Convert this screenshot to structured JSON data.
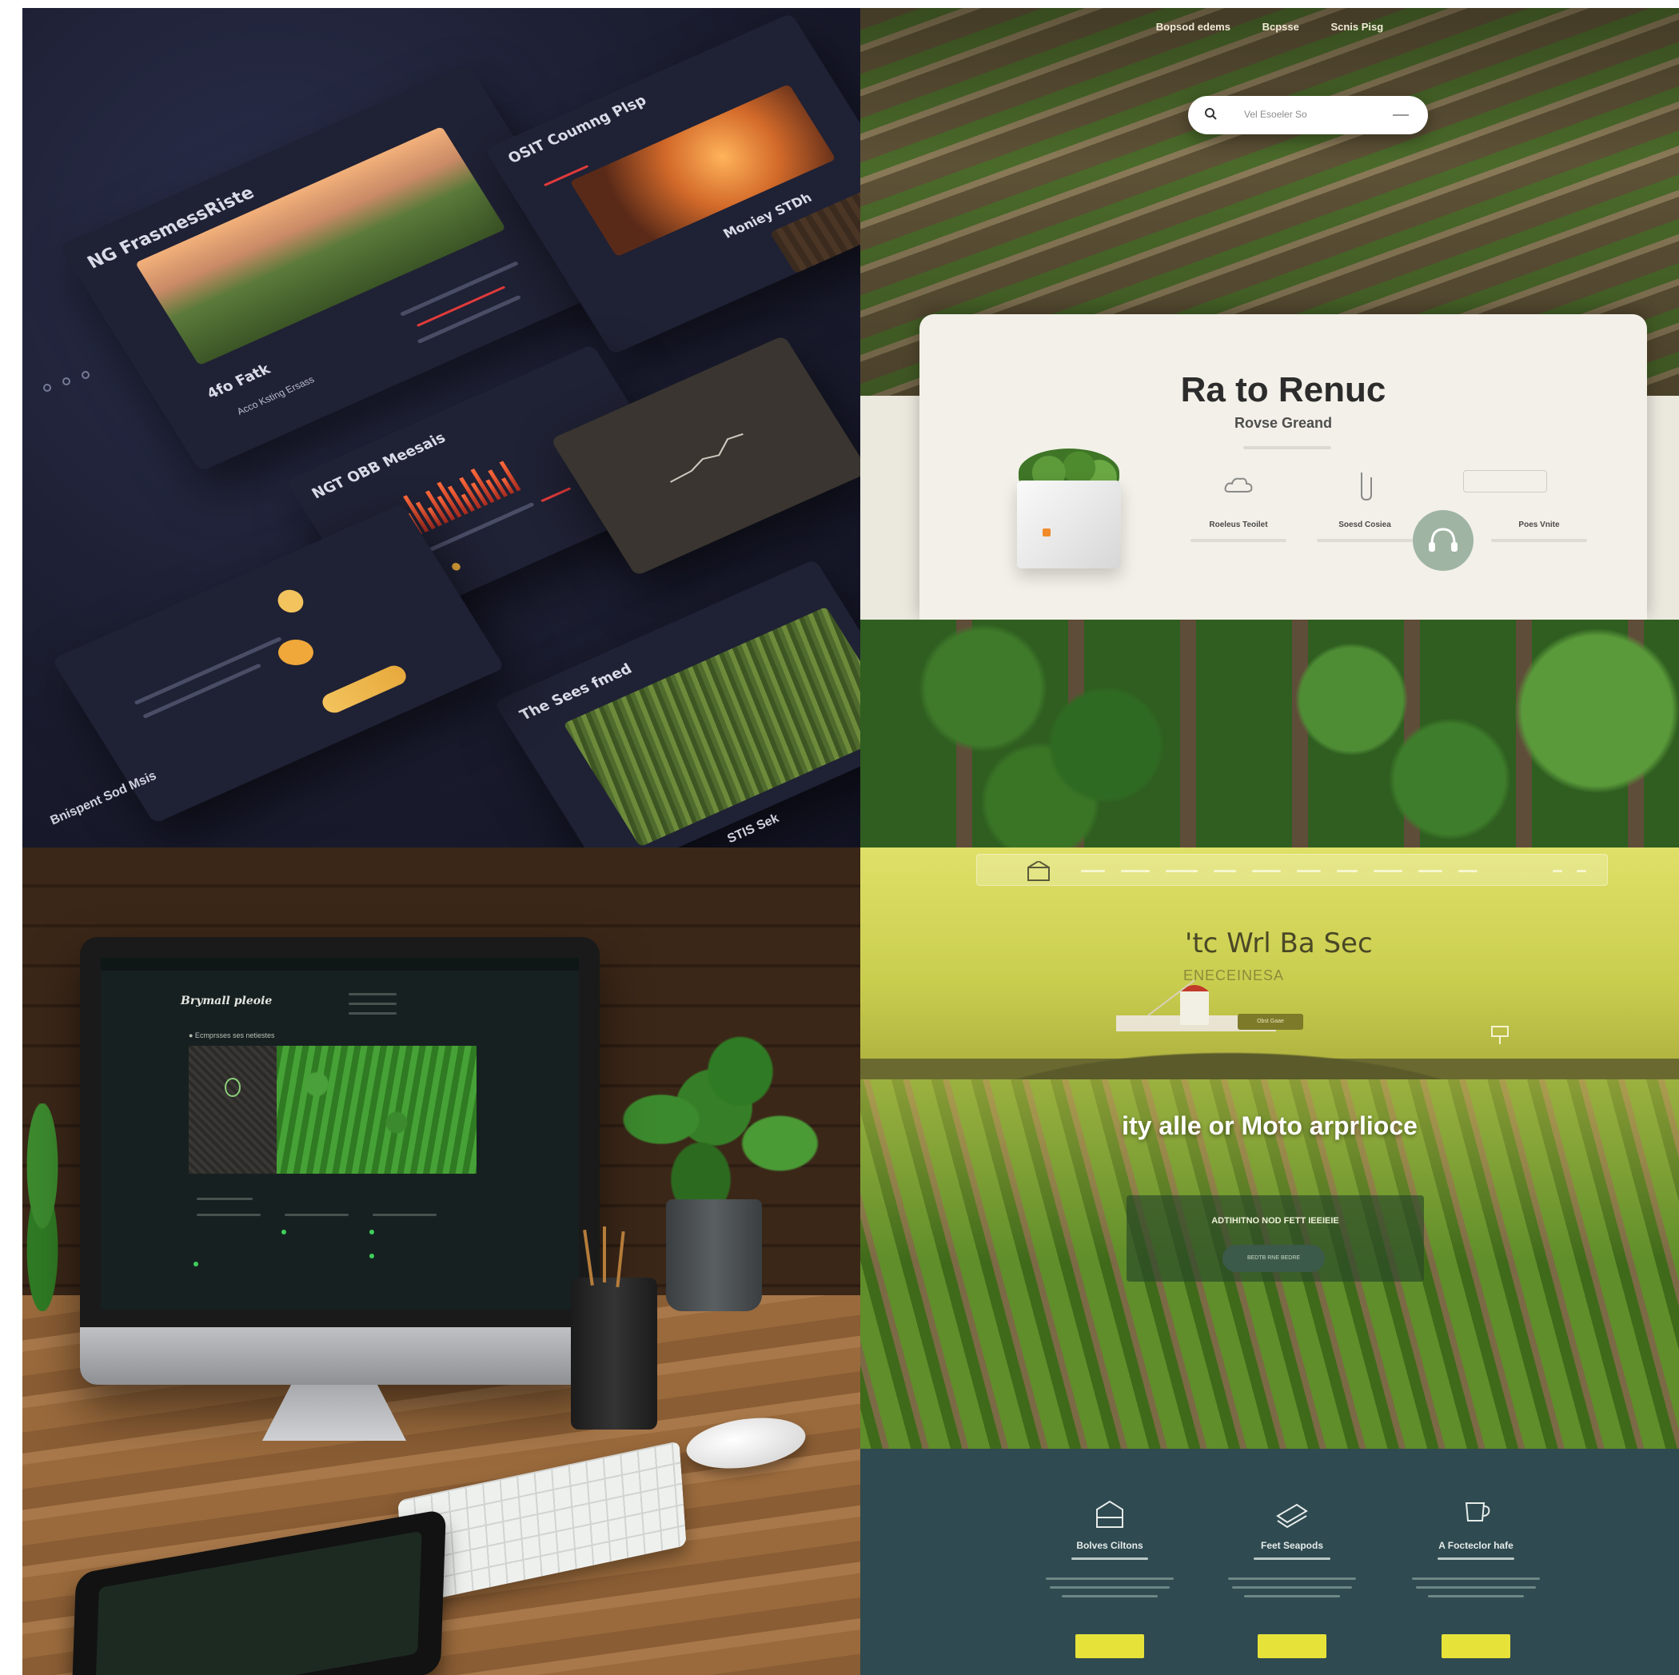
{
  "panels": {
    "top_left": {
      "card_main_title": "NG FrasmessRiste",
      "card_main_sub": "4fo Fatk",
      "card_main_item": "Acco Ksting Ersass",
      "card_top_title": "OSIT Coumng Plsp",
      "card_top_label": "Moniey STDh",
      "card_mid_title": "NGT OBB Meesais",
      "card_seed_title": "The Sees fmed",
      "card_bottom_title": "Bnispent Sod Msis",
      "card_bottom_label": "STIS Sek"
    },
    "top_right": {
      "nav_items": [
        "Bopsod edems",
        "Bcpsse",
        "Scnis Pisg"
      ],
      "search_placeholder": "Vel Esoeler So",
      "panel_title": "Ra to Renuc",
      "panel_subtitle": "Rovse Greand",
      "features": [
        {
          "label": "Roeleus Teoilet",
          "icon": "cloud-icon"
        },
        {
          "label": "Soesd Cosiea",
          "icon": "clip-icon"
        },
        {
          "label": "Poes Vnite",
          "icon": "headset-icon"
        }
      ]
    },
    "bottom_left": {
      "screen_title": "Brymall pleoie",
      "screen_line": "● Ecmprsses ses netiestes"
    },
    "bottom_right": {
      "headline": "'tc Wrl Ba Sec",
      "subheadline": "ENECEINESA",
      "chip_label": "Obst Gaae",
      "tagline": "ity alle or Moto arprlioce",
      "box_title": "ADTIHITNO NOD FETT IEEIEIE",
      "box_button": "BEDTB RNE BEDRE",
      "columns": [
        {
          "title": "Bolves Ciltons",
          "icon": "building-icon"
        },
        {
          "title": "Feet Seapods",
          "icon": "layers-icon"
        },
        {
          "title": "A Focteclor hafe",
          "icon": "cup-icon"
        }
      ]
    }
  },
  "colors": {
    "dark_bg": "#1b1d30",
    "accent_yellow": "#e6e23a",
    "footer_teal": "#2f4a50",
    "panel_cream": "#f2f0e8"
  }
}
